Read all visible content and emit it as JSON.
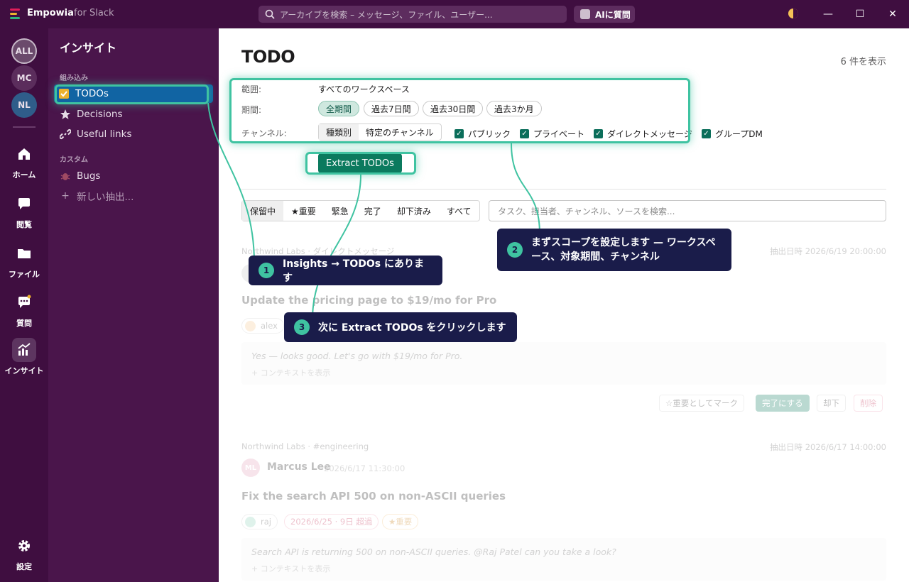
{
  "titlebar": {
    "app_name": "Empowia",
    "app_suffix": "for Slack",
    "search_placeholder": "アーカイブを検索 – メッセージ、ファイル、ユーザー...",
    "ai_button": "AIに質問"
  },
  "rail": {
    "workspaces": [
      "ALL",
      "MC",
      "NL"
    ],
    "nav": [
      {
        "label": "ホーム",
        "icon": "home-icon"
      },
      {
        "label": "閲覧",
        "icon": "chat-bubble-icon"
      },
      {
        "label": "ファイル",
        "icon": "folder-icon"
      },
      {
        "label": "質問",
        "icon": "ask-icon"
      },
      {
        "label": "インサイト",
        "icon": "insights-chart-icon"
      }
    ],
    "settings": "設定"
  },
  "sidebar": {
    "title": "インサイト",
    "builtin_section": "組み込み",
    "items": [
      {
        "label": "TODOs",
        "icon": "checkbox-icon"
      },
      {
        "label": "Decisions",
        "icon": "star-icon"
      },
      {
        "label": "Useful links",
        "icon": "link-icon"
      }
    ],
    "custom_section": "カスタム",
    "custom_items": [
      {
        "label": "Bugs",
        "icon": "bug-icon"
      },
      {
        "label": "新しい抽出...",
        "icon": "plus-icon"
      }
    ]
  },
  "main": {
    "title": "TODO",
    "count": "6 件を表示",
    "scope_label": "範囲:",
    "scope_value": "すべてのワークスペース",
    "period_label": "期間:",
    "periods": [
      "全期間",
      "過去7日間",
      "過去30日間",
      "過去3か月"
    ],
    "channel_label": "チャンネル:",
    "channel_modes": [
      "種類別",
      "特定のチャンネル"
    ],
    "channel_types": [
      "パブリック",
      "プライベート",
      "ダイレクトメッセージ",
      "グループDM"
    ],
    "extract_button": "Extract TODOs",
    "tabs": [
      "保留中",
      "★重要",
      "緊急",
      "完了",
      "却下済み",
      "すべて"
    ],
    "task_search_placeholder": "タスク、担当者、チャンネル、ソースを検索..."
  },
  "cards": [
    {
      "source": "Northwind Labs · ダイレクトメッセージ",
      "extracted": "抽出日時 2026/6/19 20:00:00",
      "task": "Update the pricing page to $19/mo for Pro",
      "assignee": "alex",
      "quote": "Yes — looks good. Let's go with $19/mo for Pro.",
      "context": "+ コンテキストを表示",
      "actions": [
        "☆重要としてマーク",
        "完了にする",
        "却下",
        "削除"
      ]
    },
    {
      "source": "Northwind Labs · #engineering",
      "extracted": "抽出日時 2026/6/17 14:00:00",
      "author_initials": "ML",
      "author": "Marcus Lee",
      "timestamp": "2026/6/17 11:30:00",
      "task": "Fix the search API 500 on non-ASCII queries",
      "assignee": "raj",
      "due": "2026/6/25 · 9日 超過",
      "flag": "★重要",
      "quote": "Search API is returning 500 on non-ASCII queries. @Raj Patel can you take a look?",
      "context": "+ コンテキストを表示"
    }
  ],
  "callouts": [
    {
      "num": "1",
      "text": "Insights → TODOs にあります"
    },
    {
      "num": "2",
      "text": "まずスコープを設定します — ワークスペース、対象期間、チャンネル"
    },
    {
      "num": "3",
      "text": "次に Extract TODOs をクリックします"
    }
  ],
  "colors": {
    "titlebar": "#3f0e40",
    "sidebar": "#4a154b",
    "active_item": "#1164a3",
    "accent": "#0b7a5e",
    "highlight": "#3fc3a1",
    "callout": "#1a1c4a"
  }
}
